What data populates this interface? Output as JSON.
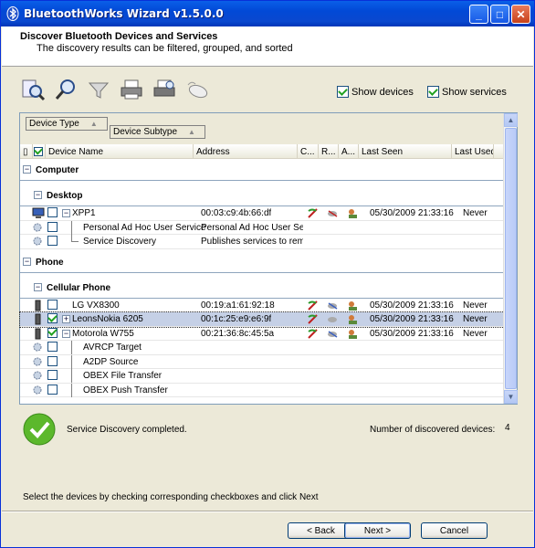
{
  "window": {
    "title": "BluetoothWorks Wizard  v1.5.0.0"
  },
  "header": {
    "title": "Discover Bluetooth Devices and Services",
    "subtitle": "The discovery results can be filtered, grouped, and sorted"
  },
  "toolbar_icons": [
    "discover-icon",
    "search-icon",
    "filter-icon",
    "print-icon",
    "print-preview-icon",
    "bluetooth-mouse-icon"
  ],
  "options": {
    "show_devices": "Show devices",
    "show_services": "Show services"
  },
  "grouping": {
    "level1": "Device Type",
    "level2": "Device Subtype"
  },
  "columns": {
    "name": "Device Name",
    "address": "Address",
    "c": "C...",
    "r": "R...",
    "a": "A...",
    "last_seen": "Last Seen",
    "last_used": "Last Used"
  },
  "groups": {
    "computer": "Computer",
    "desktop": "Desktop",
    "phone": "Phone",
    "cellular": "Cellular Phone"
  },
  "rows": {
    "xpp1": {
      "name": "XPP1",
      "address": "00:03:c9:4b:66:df",
      "last_seen": "05/30/2009 21:33:16",
      "last_used": "Never"
    },
    "svc1": {
      "name": "Personal Ad Hoc User Service",
      "address": "Personal Ad Hoc User Ser..."
    },
    "svc2": {
      "name": "Service Discovery",
      "address": "Publishes services to rem..."
    },
    "lg": {
      "name": "LG VX8300",
      "address": "00:19:a1:61:92:18",
      "last_seen": "05/30/2009 21:33:16",
      "last_used": "Never"
    },
    "nokia": {
      "name": "LeonsNokia 6205",
      "address": "00:1c:25:e9:e6:9f",
      "last_seen": "05/30/2009 21:33:16",
      "last_used": "Never"
    },
    "moto": {
      "name": "Motorola W755",
      "address": "00:21:36:8c:45:5a",
      "last_seen": "05/30/2009 21:33:16",
      "last_used": "Never"
    },
    "svc3": {
      "name": "AVRCP Target"
    },
    "svc4": {
      "name": "A2DP Source"
    },
    "svc5": {
      "name": "OBEX File Transfer"
    },
    "svc6": {
      "name": "OBEX Push Transfer"
    }
  },
  "status": {
    "message": "Service Discovery completed.",
    "count_label": "Number of discovered devices:",
    "count_value": "4"
  },
  "instruction": "Select the devices by checking corresponding checkboxes and click Next",
  "buttons": {
    "back": "< Back",
    "next": "Next >",
    "cancel": "Cancel"
  }
}
